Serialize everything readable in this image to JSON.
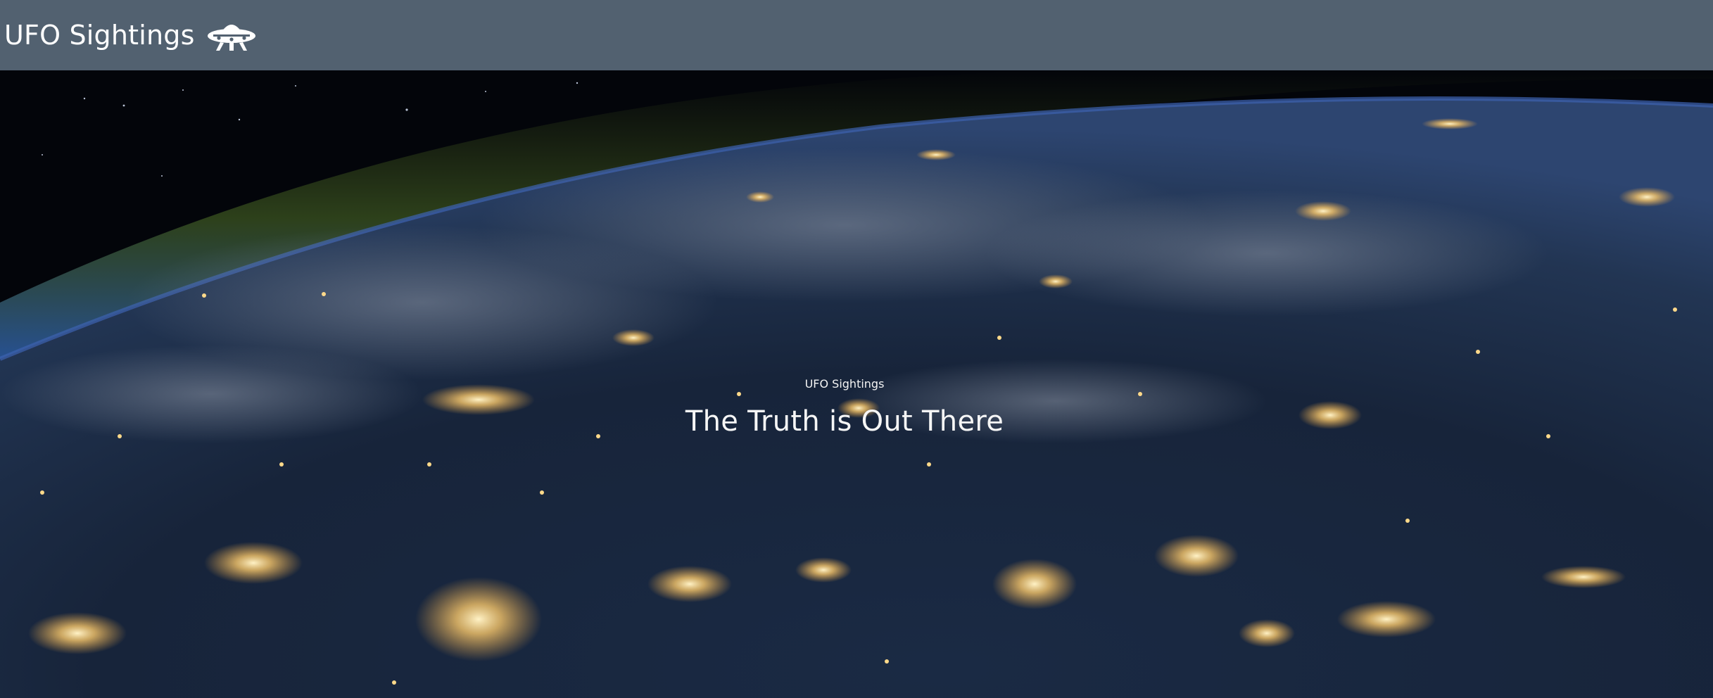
{
  "navbar": {
    "brand_label": "UFO Sightings",
    "brand_icon": "ufo-icon",
    "background": "#526170"
  },
  "hero": {
    "background_image": "earth-at-night-from-orbit",
    "subtitle": "UFO Sightings",
    "title": "The Truth is Out There",
    "text_color": "#ffffff"
  }
}
